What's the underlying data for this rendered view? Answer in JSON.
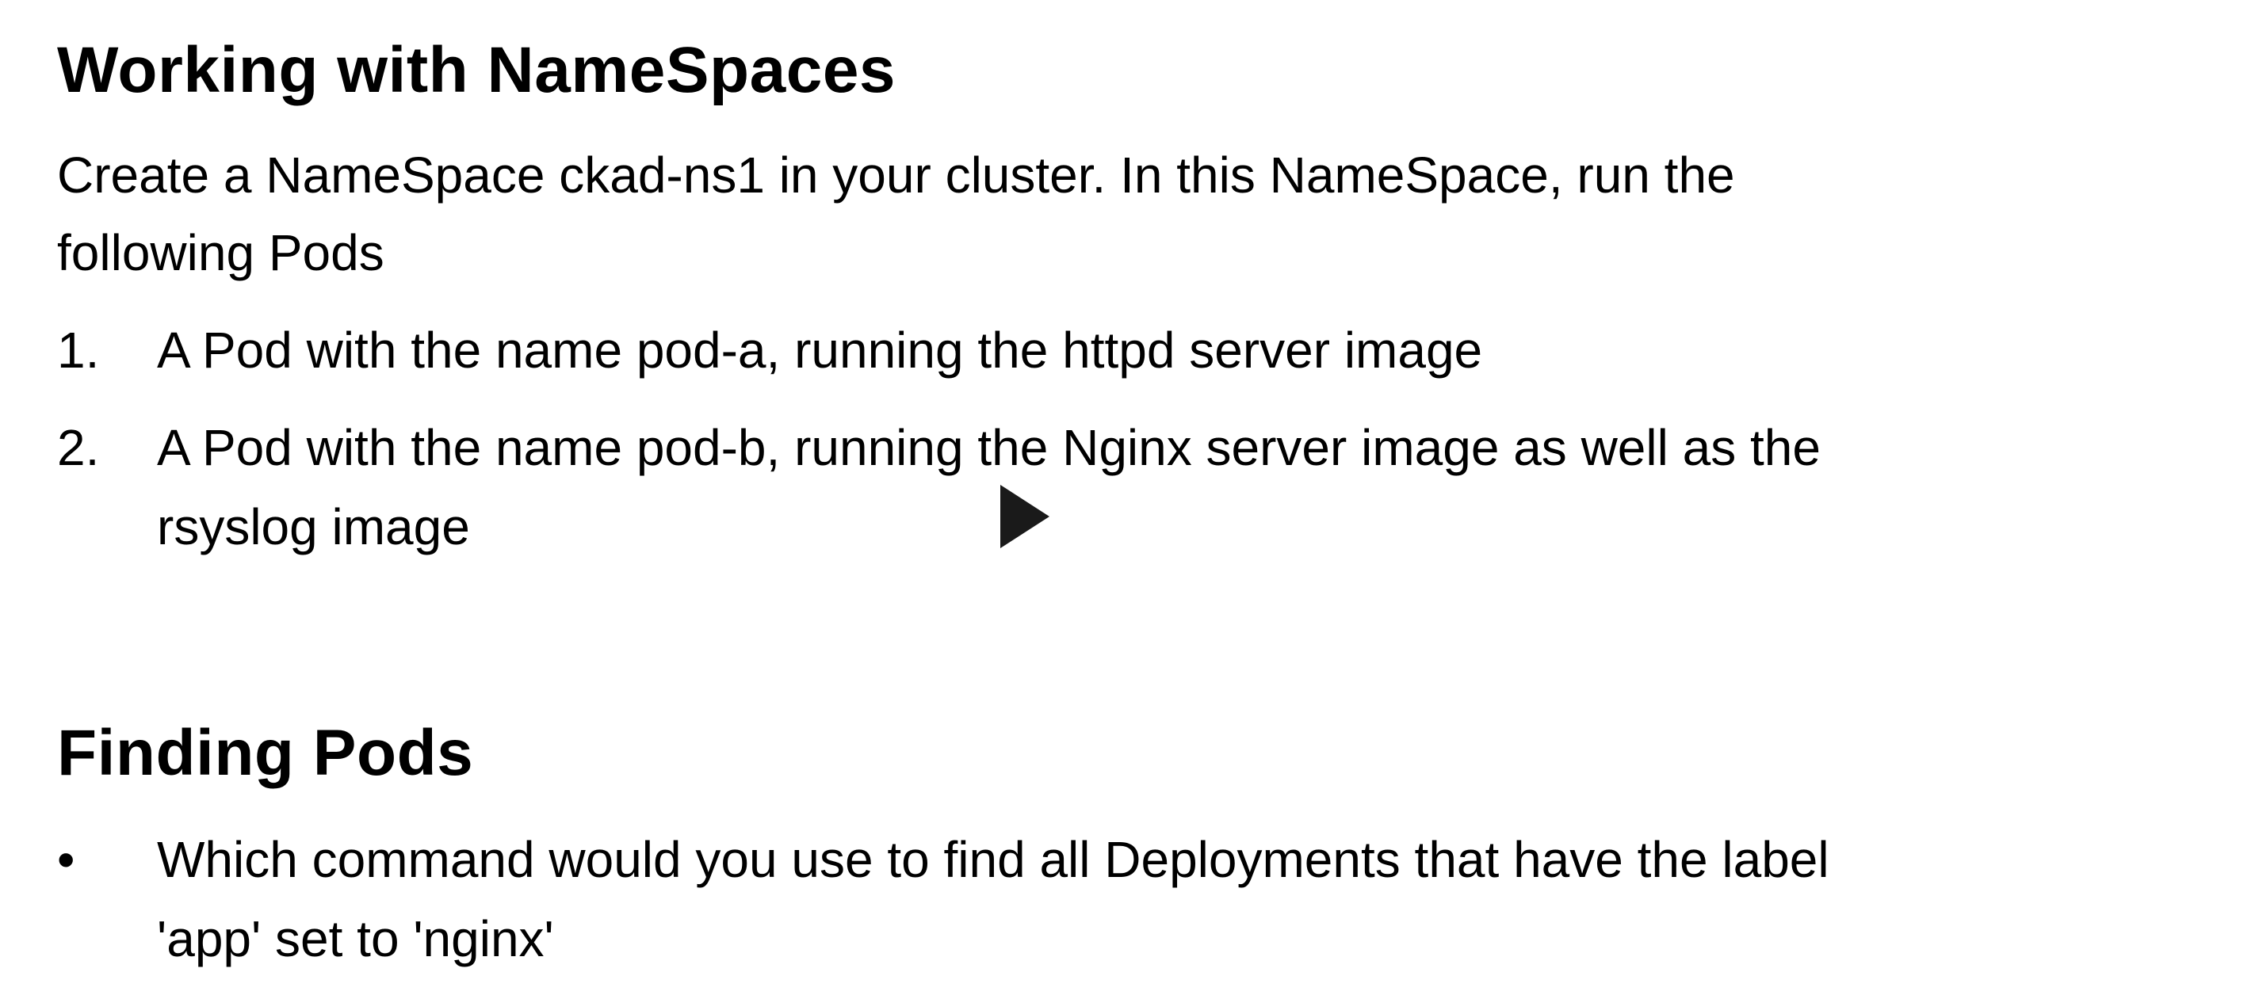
{
  "section1": {
    "title": "Working with NameSpaces",
    "intro_line1": "Create a NameSpace ckad-ns1 in your cluster. In this NameSpace, run the",
    "intro_line2": "following Pods",
    "items": [
      {
        "marker": "1.",
        "line1": "A Pod with the name pod-a, running the httpd server image"
      },
      {
        "marker": "2.",
        "line1": "A Pod with the name pod-b, running the Nginx server image as well as the",
        "line2": "rsyslog image"
      }
    ]
  },
  "section2": {
    "title": "Finding Pods",
    "items": [
      {
        "marker": "•",
        "line1": "Which command would you use to find all Deployments that have the label",
        "line2": "'app' set to 'nginx'"
      }
    ]
  },
  "player": {
    "play_icon": "play-icon"
  }
}
